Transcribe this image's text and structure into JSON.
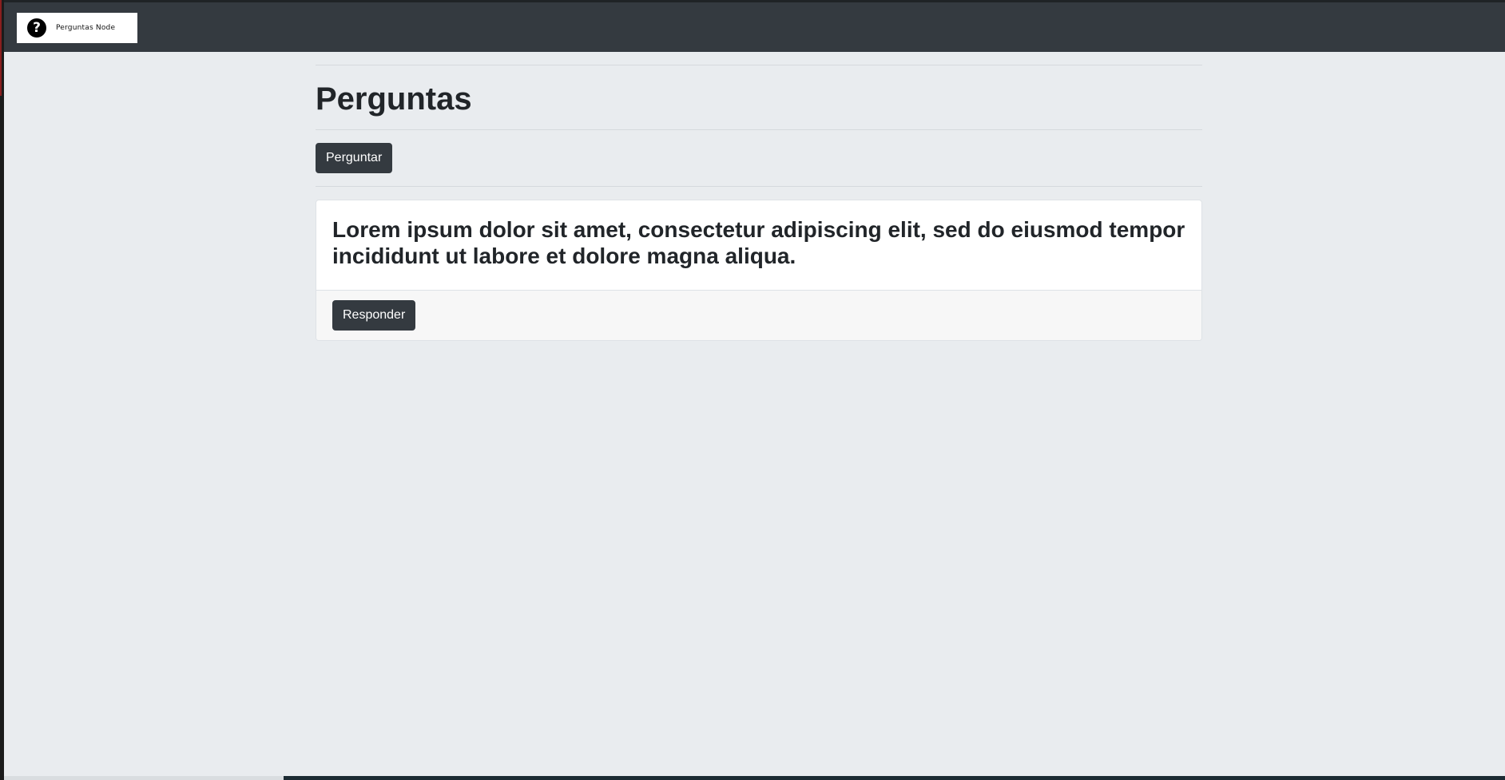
{
  "navbar": {
    "brand_label": "Perguntas Node",
    "brand_icon": "question-circle-icon",
    "background": "#343a40"
  },
  "main": {
    "title": "Perguntas",
    "ask_button_label": "Perguntar"
  },
  "questions": [
    {
      "text": "Lorem ipsum dolor sit amet, consectetur adipiscing elit, sed do eiusmod tempor incididunt ut labore et dolore magna aliqua.",
      "answer_button_label": "Responder"
    }
  ],
  "colors": {
    "page_background": "#e9ecef",
    "button_background": "#343a40",
    "card_background": "#ffffff",
    "card_footer_background": "#f7f7f7"
  }
}
